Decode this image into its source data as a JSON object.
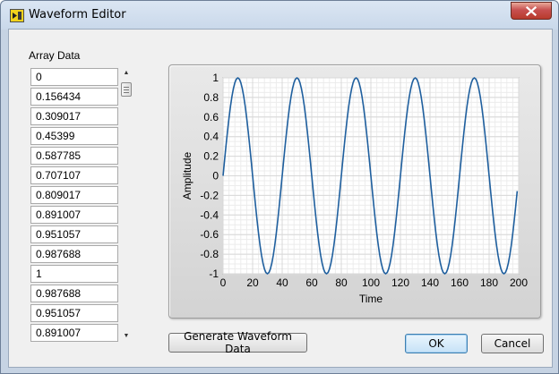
{
  "window": {
    "title": "Waveform Editor"
  },
  "array": {
    "label": "Array Data",
    "values": [
      "0",
      "0.156434",
      "0.309017",
      "0.45399",
      "0.587785",
      "0.707107",
      "0.809017",
      "0.891007",
      "0.951057",
      "0.987688",
      "1",
      "0.987688",
      "0.951057",
      "0.891007"
    ]
  },
  "buttons": {
    "generate": "Generate Waveform Data",
    "ok": "OK",
    "cancel": "Cancel"
  },
  "icons": {
    "app": "labview-vi-icon",
    "close": "close-icon",
    "scroll_up": "scroll-up-icon",
    "scroll_down": "scroll-down-icon"
  },
  "colors": {
    "trace": "#1f5f9e",
    "plot_bg": "#ffffff",
    "grid": "#d8d8d8",
    "frame": "#d9d9d9"
  },
  "chart_data": {
    "type": "line",
    "title": "",
    "xlabel": "Time",
    "ylabel": "Amplitude",
    "xlim": [
      0,
      200
    ],
    "ylim": [
      -1,
      1
    ],
    "xticks": [
      "0",
      "20",
      "40",
      "60",
      "80",
      "100",
      "120",
      "140",
      "160",
      "180",
      "200"
    ],
    "yticks": [
      "1",
      "0.8",
      "0.6",
      "0.4",
      "0.2",
      "0",
      "-0.2",
      "-0.4",
      "-0.6",
      "-0.8",
      "-1"
    ],
    "grid": true,
    "series": [
      {
        "function": "sine",
        "amplitude": 1,
        "period": 40,
        "x_start": 0,
        "x_end": 199,
        "x_step": 1
      }
    ]
  }
}
